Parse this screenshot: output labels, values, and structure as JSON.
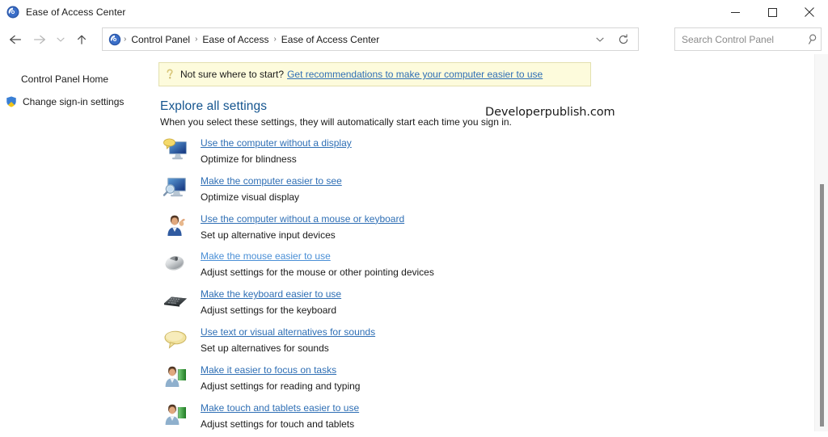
{
  "window": {
    "title": "Ease of Access Center",
    "app_icon": "ease-of-access-icon",
    "controls": {
      "minimize": "Minimize",
      "maximize": "Maximize",
      "close": "Close"
    }
  },
  "navbar": {
    "back": "Back",
    "forward": "Forward",
    "recent": "Recent locations",
    "up": "Up one level",
    "address_icon": "ease-of-access-icon",
    "breadcrumbs": [
      "Control Panel",
      "Ease of Access",
      "Ease of Access Center"
    ],
    "separator": "›",
    "dropdown": "Previous locations",
    "refresh": "Refresh"
  },
  "search": {
    "placeholder": "Search Control Panel",
    "value": "",
    "icon": "search-icon"
  },
  "sidebar": {
    "items": [
      {
        "label": "Control Panel Home",
        "icon": null
      },
      {
        "label": "Change sign-in settings",
        "icon": "shield-icon"
      }
    ]
  },
  "notice": {
    "icon": "question-mark-icon",
    "text": "Not sure where to start?",
    "link": "Get recommendations to make your computer easier to use"
  },
  "main": {
    "heading": "Explore all settings",
    "subheading": "When you select these settings, they will automatically start each time you sign in.",
    "watermark": "Developerpublish.com"
  },
  "settings": [
    {
      "link": "Use the computer without a display",
      "desc": "Optimize for blindness",
      "icon": "monitor-speech-bubble-icon",
      "hovered": false
    },
    {
      "link": "Make the computer easier to see",
      "desc": "Optimize visual display",
      "icon": "monitor-magnifier-icon",
      "hovered": false
    },
    {
      "link": "Use the computer without a mouse or keyboard",
      "desc": "Set up alternative input devices",
      "icon": "person-hand-icon",
      "hovered": false
    },
    {
      "link": "Make the mouse easier to use",
      "desc": "Adjust settings for the mouse or other pointing devices",
      "icon": "mouse-icon",
      "hovered": true
    },
    {
      "link": "Make the keyboard easier to use",
      "desc": "Adjust settings for the keyboard",
      "icon": "keyboard-icon",
      "hovered": false
    },
    {
      "link": "Use text or visual alternatives for sounds",
      "desc": "Set up alternatives for sounds",
      "icon": "speech-bubble-icon",
      "hovered": false
    },
    {
      "link": "Make it easier to focus on tasks",
      "desc": "Adjust settings for reading and typing",
      "icon": "person-book-icon",
      "hovered": false
    },
    {
      "link": "Make touch and tablets easier to use",
      "desc": "Adjust settings for touch and tablets",
      "icon": "person-book-icon",
      "hovered": false
    }
  ],
  "scrollbar": {
    "name": "vertical-scrollbar"
  },
  "colors": {
    "link": "#2f6fb5",
    "heading": "#15558f",
    "notice_bg": "#fdfbdc",
    "notice_border": "#e3e0af"
  }
}
